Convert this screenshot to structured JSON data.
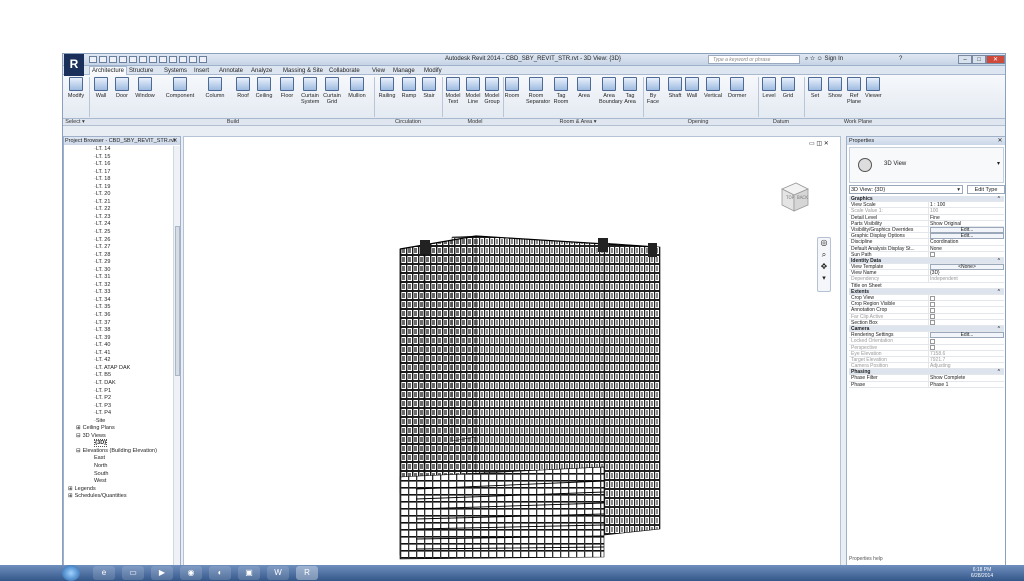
{
  "window": {
    "title": "Autodesk Revit 2014 -    CBD_SBY_REVIT_STR.rvt - 3D View: {3D}",
    "search_placeholder": "Type a keyword or phrase",
    "sign_in": "Sign In",
    "logo": "R"
  },
  "tabs": [
    "Architecture",
    "Structure",
    "Systems",
    "Insert",
    "Annotate",
    "Analyze",
    "Massing & Site",
    "Collaborate",
    "View",
    "Manage",
    "Modify"
  ],
  "ribbon": {
    "buttons": [
      {
        "label": "Modify"
      },
      {
        "label": "Wall"
      },
      {
        "label": "Door"
      },
      {
        "label": "Window"
      },
      {
        "label": "Component"
      },
      {
        "label": "Column"
      },
      {
        "label": "Roof"
      },
      {
        "label": "Ceiling"
      },
      {
        "label": "Floor"
      },
      {
        "label": "Curtain System"
      },
      {
        "label": "Curtain Grid"
      },
      {
        "label": "Mullion"
      },
      {
        "label": "Railing"
      },
      {
        "label": "Ramp"
      },
      {
        "label": "Stair"
      },
      {
        "label": "Model Text"
      },
      {
        "label": "Model Line"
      },
      {
        "label": "Model Group"
      },
      {
        "label": "Room"
      },
      {
        "label": "Room Separator"
      },
      {
        "label": "Tag Room"
      },
      {
        "label": "Area"
      },
      {
        "label": "Area Boundary"
      },
      {
        "label": "Tag Area"
      },
      {
        "label": "By Face"
      },
      {
        "label": "Shaft"
      },
      {
        "label": "Wall"
      },
      {
        "label": "Vertical"
      },
      {
        "label": "Dormer"
      },
      {
        "label": "Level"
      },
      {
        "label": "Grid"
      },
      {
        "label": "Set"
      },
      {
        "label": "Show"
      },
      {
        "label": "Ref Plane"
      },
      {
        "label": "Viewer"
      }
    ],
    "panels": [
      "Select ▾",
      "Build",
      "Circulation",
      "Model",
      "Room & Area ▾",
      "Opening",
      "Datum",
      "Work Plane"
    ]
  },
  "browser": {
    "title": "Project Browser - CBD_SBY_REVIT_STR.rvt",
    "close": "✕",
    "items": [
      "LT. 14",
      "LT. 15",
      "LT. 16",
      "LT. 17",
      "LT. 18",
      "LT. 19",
      "LT. 20",
      "LT. 21",
      "LT. 22",
      "LT. 23",
      "LT. 24",
      "LT. 25",
      "LT. 26",
      "LT. 27",
      "LT. 28",
      "LT. 29",
      "LT. 30",
      "LT. 31",
      "LT. 32",
      "LT. 33",
      "LT. 34",
      "LT. 35",
      "LT. 36",
      "LT. 37",
      "LT. 38",
      "LT. 39",
      "LT. 40",
      "LT. 41",
      "LT. 42",
      "LT. ATAP DAK",
      "LT. B5",
      "LT. DAK",
      "LT. P1",
      "LT. P2",
      "LT. P3",
      "LT. P4",
      "Site"
    ],
    "tail": [
      {
        "label": "Ceiling Plans",
        "sym": "⊞"
      },
      {
        "label": "3D Views",
        "sym": "⊟"
      },
      {
        "label": "{3D}",
        "sym": ""
      },
      {
        "label": "Elevations (Building Elevation)",
        "sym": "⊟"
      },
      {
        "label": "East",
        "sym": ""
      },
      {
        "label": "North",
        "sym": ""
      },
      {
        "label": "South",
        "sym": ""
      },
      {
        "label": "West",
        "sym": ""
      },
      {
        "label": "Legends",
        "sym": "⊞"
      },
      {
        "label": "Schedules/Quantities",
        "sym": "⊞"
      }
    ]
  },
  "viewcube": {
    "top": "TOP",
    "back": "BACK"
  },
  "properties": {
    "title": "Properties",
    "close": "✕",
    "type_name": "3D View",
    "instance": "3D View: {3D}",
    "edit_type": "Edit Type",
    "rows": [
      {
        "kind": "group",
        "name": "Graphics"
      },
      {
        "name": "View Scale",
        "value": "1 : 100"
      },
      {
        "name": "Scale Value   1:",
        "value": "100",
        "dim": true
      },
      {
        "name": "Detail Level",
        "value": "Fine"
      },
      {
        "name": "Parts Visibility",
        "value": "Show Original"
      },
      {
        "name": "Visibility/Graphics Overrides",
        "value": "Edit...",
        "button": true
      },
      {
        "name": "Graphic Display Options",
        "value": "Edit...",
        "button": true
      },
      {
        "name": "Discipline",
        "value": "Coordination"
      },
      {
        "name": "Default Analysis Display St...",
        "value": "None"
      },
      {
        "name": "Sun Path",
        "value": "",
        "check": true
      },
      {
        "kind": "group",
        "name": "Identity Data"
      },
      {
        "name": "View Template",
        "value": "<None>",
        "button": true
      },
      {
        "name": "View Name",
        "value": "{3D}"
      },
      {
        "name": "Dependency",
        "value": "Independent",
        "dim": true
      },
      {
        "name": "Title on Sheet",
        "value": ""
      },
      {
        "kind": "group",
        "name": "Extents"
      },
      {
        "name": "Crop View",
        "value": "",
        "check": true
      },
      {
        "name": "Crop Region Visible",
        "value": "",
        "check": true
      },
      {
        "name": "Annotation Crop",
        "value": "",
        "check": true
      },
      {
        "name": "Far Clip Active",
        "value": "",
        "check": true,
        "dim": true
      },
      {
        "name": "Section Box",
        "value": "",
        "check": true
      },
      {
        "kind": "group",
        "name": "Camera"
      },
      {
        "name": "Rendering Settings",
        "value": "Edit...",
        "button": true
      },
      {
        "name": "Locked Orientation",
        "value": "",
        "check": true,
        "dim": true
      },
      {
        "name": "Perspective",
        "value": "",
        "check": true,
        "dim": true
      },
      {
        "name": "Eye Elevation",
        "value": "7158.6",
        "dim": true
      },
      {
        "name": "Target Elevation",
        "value": "7921.7",
        "dim": true
      },
      {
        "name": "Camera Position",
        "value": "Adjusting",
        "dim": true
      },
      {
        "kind": "group",
        "name": "Phasing"
      },
      {
        "name": "Phase Filter",
        "value": "Show Complete"
      },
      {
        "name": "Phase",
        "value": "Phase 1"
      }
    ],
    "footer": "Properties help"
  },
  "taskbar": {
    "clock_time": "6:18 PM",
    "clock_date": "6/28/2014"
  }
}
